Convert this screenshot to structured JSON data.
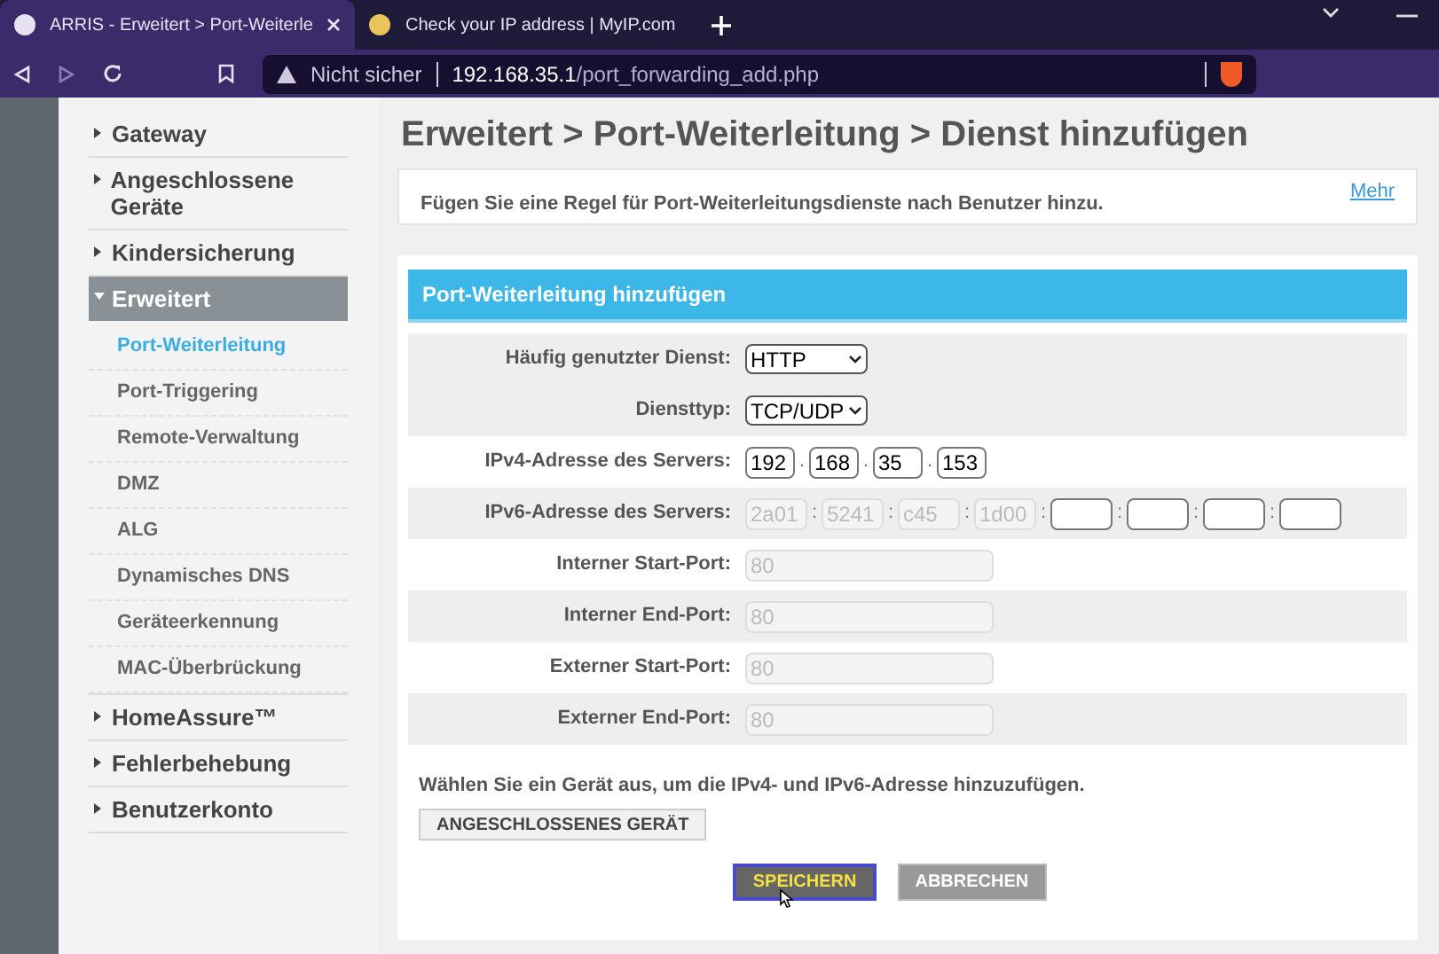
{
  "browser": {
    "tabs": [
      {
        "title": "ARRIS - Erweitert > Port-Weiterle",
        "selected": true
      },
      {
        "title": "Check your IP address | MyIP.com",
        "selected": false
      }
    ],
    "security": "Nicht sicher",
    "url_host": "192.168.35.1",
    "url_path": "/port_forwarding_add.php"
  },
  "sidebar": {
    "items": [
      {
        "label": "Gateway",
        "expanded": false,
        "selected": false
      },
      {
        "label": "Angeschlossene Geräte",
        "expanded": false,
        "selected": false
      },
      {
        "label": "Kindersicherung",
        "expanded": false,
        "selected": false
      },
      {
        "label": "Erweitert",
        "expanded": true,
        "selected": true,
        "children": [
          {
            "label": "Port-Weiterleitung",
            "selected": true
          },
          {
            "label": "Port-Triggering",
            "selected": false
          },
          {
            "label": "Remote-Verwaltung",
            "selected": false
          },
          {
            "label": "DMZ",
            "selected": false
          },
          {
            "label": "ALG",
            "selected": false
          },
          {
            "label": "Dynamisches DNS",
            "selected": false
          },
          {
            "label": "Geräteerkennung",
            "selected": false
          },
          {
            "label": "MAC-Überbrückung",
            "selected": false
          }
        ]
      },
      {
        "label": "HomeAssure™",
        "expanded": false,
        "selected": false
      },
      {
        "label": "Fehlerbehebung",
        "expanded": false,
        "selected": false
      },
      {
        "label": "Benutzerkonto",
        "expanded": false,
        "selected": false
      }
    ]
  },
  "heading": "Erweitert > Port-Weiterleitung > Dienst hinzufügen",
  "info": {
    "text": "Fügen Sie eine Regel für Port-Weiterleitungsdienste nach Benutzer hinzu.",
    "link": "Mehr"
  },
  "form": {
    "title": "Port-Weiterleitung hinzufügen",
    "rows": [
      {
        "label": "Häufig genutzter Dienst:",
        "kind": "select",
        "value": "HTTP"
      },
      {
        "label": "Diensttyp:",
        "kind": "select",
        "value": "TCP/UDP"
      },
      {
        "label": "IPv4-Adresse des Servers:",
        "kind": "ipv4",
        "separator": ".",
        "parts": [
          {
            "value": "192",
            "disabled": false
          },
          {
            "value": "168",
            "disabled": false
          },
          {
            "value": "35",
            "disabled": false
          },
          {
            "value": "153",
            "disabled": false
          }
        ]
      },
      {
        "label": "IPv6-Adresse des Servers:",
        "kind": "ipv6",
        "separator": ":",
        "parts": [
          {
            "value": "2a01",
            "disabled": true
          },
          {
            "value": "5241",
            "disabled": true
          },
          {
            "value": "c45",
            "disabled": true
          },
          {
            "value": "1d00",
            "disabled": true
          },
          {
            "disabled": false
          },
          {
            "disabled": false
          },
          {
            "disabled": false
          },
          {
            "disabled": false
          }
        ]
      },
      {
        "label": "Interner Start-Port:",
        "kind": "text",
        "value": "80",
        "disabled": true
      },
      {
        "label": "Interner End-Port:",
        "kind": "text",
        "value": "80",
        "disabled": true
      },
      {
        "label": "Externer Start-Port:",
        "kind": "text",
        "value": "80",
        "disabled": true
      },
      {
        "label": "Externer End-Port:",
        "kind": "text",
        "value": "80",
        "disabled": true
      }
    ],
    "device_hint": "Wählen Sie ein Gerät aus, um die IPv4- und IPv6-Adresse hinzuzufügen.",
    "device_button": "ANGESCHLOSSENES GERÄT",
    "buttons": [
      {
        "label": "SPEICHERN",
        "kind": "primary",
        "focused": true
      },
      {
        "label": "ABBRECHEN",
        "kind": "secondary",
        "focused": false
      }
    ]
  }
}
